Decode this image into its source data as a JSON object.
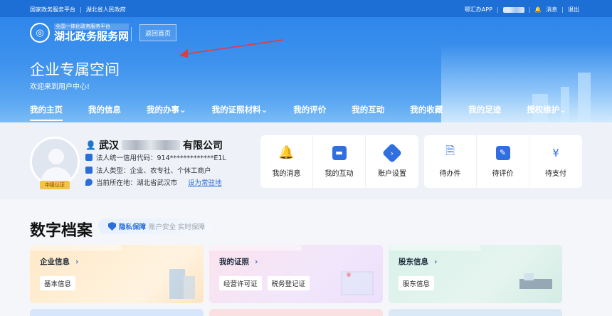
{
  "topbar": {
    "left_links": [
      "国家政务服务平台",
      "湖北省人民政府"
    ],
    "app_link": "鄂汇办APP",
    "messages": "消息",
    "logout": "退出"
  },
  "header": {
    "logo_small": "全国一体化政务服务平台",
    "logo_main": "湖北政务服务网",
    "home_button": "返回首页",
    "title": "企业专属空间",
    "subtitle": "欢迎来到用户中心!"
  },
  "nav": {
    "items": [
      "我的主页",
      "我的信息",
      "我的办事",
      "我的证照材料",
      "我的评价",
      "我的互动",
      "我的收藏",
      "我的足迹",
      "授权维护"
    ],
    "active": 0
  },
  "profile": {
    "name_prefix": "武汉",
    "name_suffix": "有限公司",
    "credit_code": "法人统一信用代码：914*************E1L",
    "legal_type": "法人类型：企业、农专社、个体工商户",
    "location": "当前所在地：湖北省武汉市",
    "set_default": "设为常驻地",
    "level_badge": "中级认证"
  },
  "quick_a": [
    "我的消息",
    "我的互动",
    "账户设置"
  ],
  "quick_b": [
    "待办件",
    "待评价",
    "待支付"
  ],
  "archive": {
    "title": "数字档案",
    "privacy_strong": "隐私保障",
    "privacy_weak": "账户安全 实时保障",
    "cards": [
      {
        "title": "企业信息",
        "chips": [
          "基本信息"
        ]
      },
      {
        "title": "我的证照",
        "chips": [
          "经营许可证",
          "税务登记证"
        ]
      },
      {
        "title": "股东信息",
        "chips": [
          "股东信息"
        ]
      }
    ]
  },
  "colors": {
    "primary": "#2a6fd8",
    "hero": "#3f93ee",
    "badge": "#f3c34b"
  }
}
